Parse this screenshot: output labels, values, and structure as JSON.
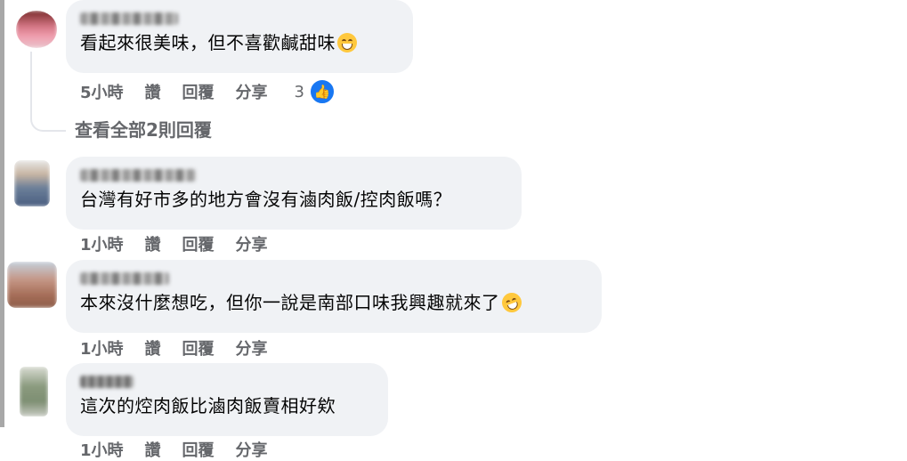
{
  "comments": [
    {
      "text": "看起來很美味，但不喜歡鹹甜味",
      "emoji": "smiling-sweat-emoji",
      "time": "5小時",
      "like": "讚",
      "reply": "回覆",
      "share": "分享",
      "reaction_count": "3"
    },
    {
      "text": "台灣有好市多的地方會沒有滷肉飯/控肉飯嗎？",
      "time": "1小時",
      "like": "讚",
      "reply": "回覆",
      "share": "分享"
    },
    {
      "text": "本來沒什麼想吃，但你一說是南部口味我興趣就來了",
      "emoji": "rofl-emoji",
      "time": "1小時",
      "like": "讚",
      "reply": "回覆",
      "share": "分享"
    },
    {
      "text": "這次的焢肉飯比滷肉飯賣相好欸",
      "time": "1小時",
      "like": "讚",
      "reply": "回覆",
      "share": "分享"
    }
  ],
  "view_replies": "查看全部2則回覆",
  "colors": {
    "bubble": "#f0f2f5",
    "secondary_text": "#65676b",
    "like_blue": "#1877f2"
  }
}
